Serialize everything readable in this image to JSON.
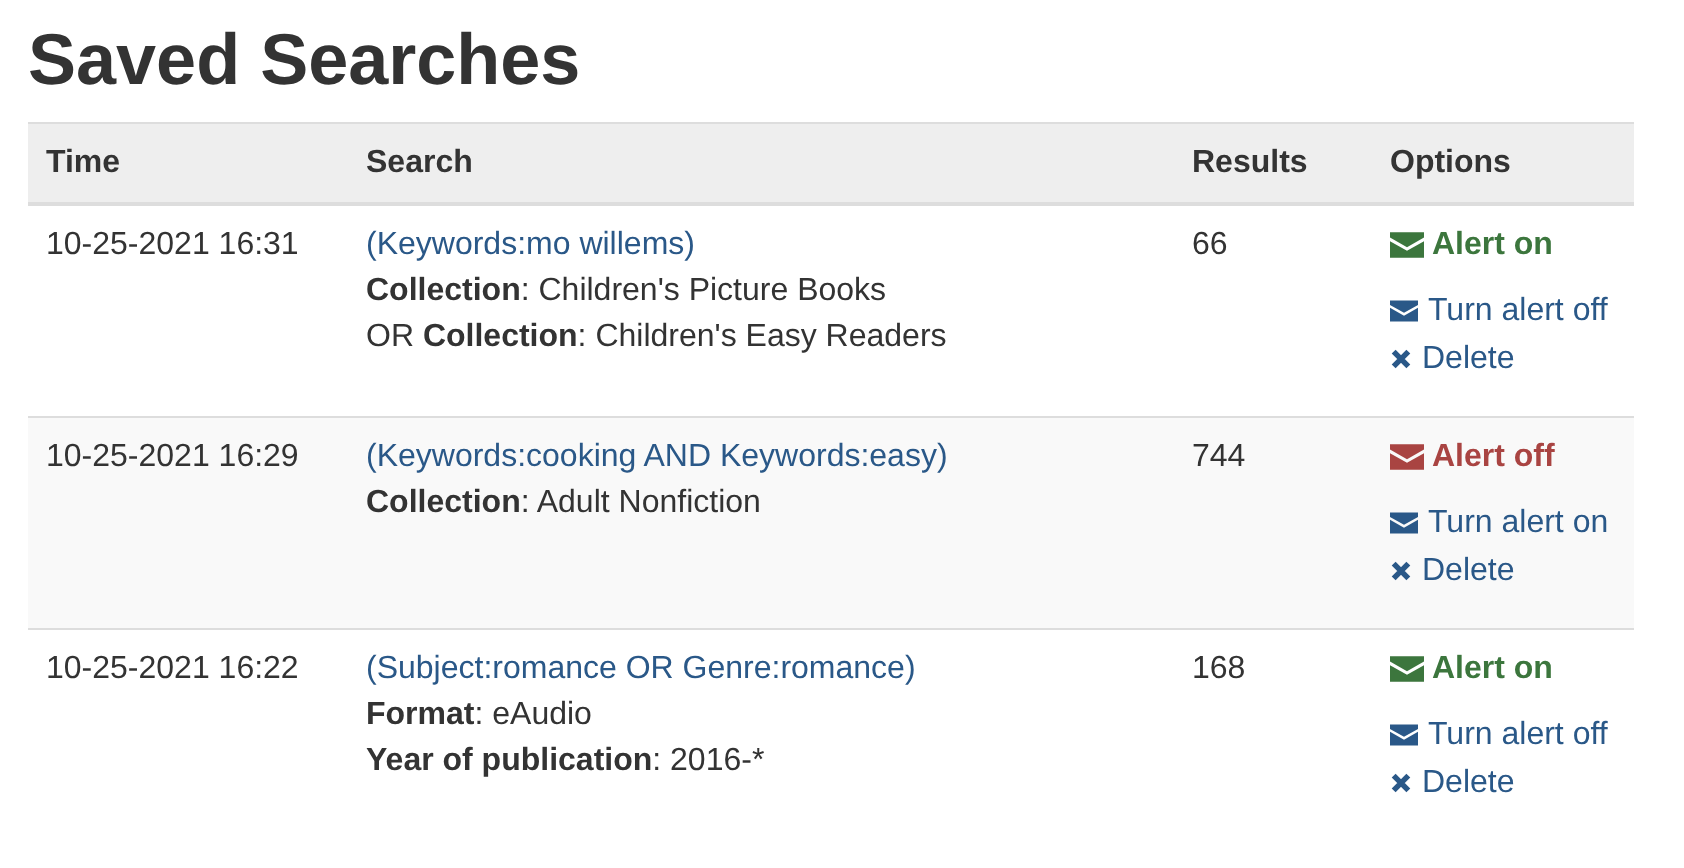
{
  "title": "Saved Searches",
  "table": {
    "columns": [
      "Time",
      "Search",
      "Results",
      "Options"
    ],
    "rows": [
      {
        "time": "10-25-2021 16:31",
        "query": "(Keywords:mo willems)",
        "filters": [
          "**Collection**: Children's Picture Books",
          "OR **Collection**: Children's Easy Readers"
        ],
        "results": "66",
        "alert_on": true,
        "alert_status": "Alert on",
        "toggle_action": "Turn alert off",
        "delete_action": "Delete"
      },
      {
        "time": "10-25-2021 16:29",
        "query": "(Keywords:cooking AND Keywords:easy)",
        "filters": [
          "**Collection**: Adult Nonfiction"
        ],
        "results": "744",
        "alert_on": false,
        "alert_status": "Alert off",
        "toggle_action": "Turn alert on",
        "delete_action": "Delete"
      },
      {
        "time": "10-25-2021 16:22",
        "query": "(Subject:romance OR Genre:romance)",
        "filters": [
          "**Format**: eAudio",
          "**Year of publication**: 2016-*"
        ],
        "results": "168",
        "alert_on": true,
        "alert_status": "Alert on",
        "toggle_action": "Turn alert off",
        "delete_action": "Delete"
      }
    ]
  }
}
